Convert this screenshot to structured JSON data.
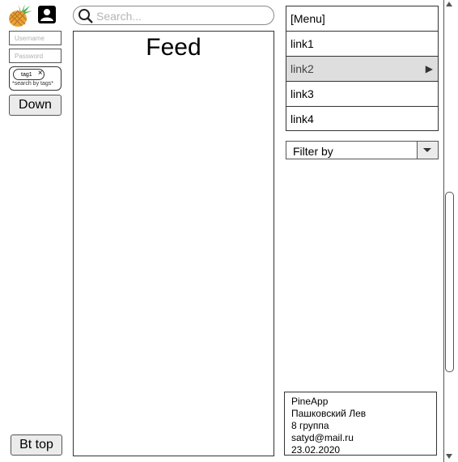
{
  "left": {
    "username_placeholder": "Username",
    "password_placeholder": "Password",
    "tags": [
      {
        "label": "tag1"
      }
    ],
    "tags_hint": "*search by tags*",
    "down_label": "Down",
    "bttop_label": "Bt top"
  },
  "search": {
    "placeholder": "Search..."
  },
  "feed": {
    "title": "Feed"
  },
  "menu": {
    "items": [
      {
        "label": "[Menu]"
      },
      {
        "label": "link1"
      },
      {
        "label": "link2",
        "selected": true,
        "arrow": "▶"
      },
      {
        "label": "link3"
      },
      {
        "label": "link4"
      }
    ]
  },
  "filter": {
    "label": "Filter by"
  },
  "footer": {
    "app": "PineApp",
    "author": "Пашковский Лев",
    "group": "8 группа",
    "email": "satyd@mail.ru",
    "date": "23.02.2020"
  },
  "icons": {
    "logo": "pineapple-icon",
    "user": "user-icon",
    "search": "search-icon",
    "tag_remove": "close-icon",
    "menu_arrow": "triangle-right-icon",
    "filter_caret": "chevron-down-icon"
  },
  "colors": {
    "logo_body": "#e8a43a",
    "logo_leaves": "#4caf50",
    "selected_row": "#dedede"
  }
}
